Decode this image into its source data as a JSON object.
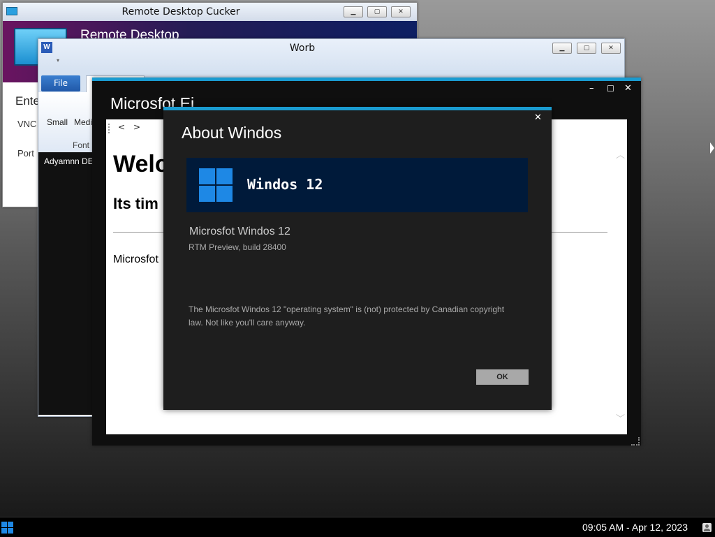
{
  "rdc": {
    "title": "Remote Desktop Cucker",
    "banner_title": "Remote Desktop",
    "enter_label": "Ente",
    "vnc_label": "VNC",
    "port_label": "Port"
  },
  "worb": {
    "title": "Worb",
    "file_tab": "File",
    "font_small": "Small",
    "font_medium": "Medi",
    "font_group_label": "Font",
    "status_text": "Adyamnn DE"
  },
  "browser": {
    "title": "Microsfot Ei",
    "back_label": "<",
    "forward_label": ">",
    "heading": "Welco",
    "subheading": "Its tim",
    "paragraph": "Microsfot"
  },
  "about": {
    "title": "About Windos",
    "close_label": "✕",
    "product_name": "Windos 12",
    "full_name": "Microsfot Windos 12",
    "build": "RTM Preview, build 28400",
    "legal": "The Microsfot Windos 12 \"operating system\" is (not) protected by Canadian copyright law. Not like you'll care anyway.",
    "ok_label": "OK"
  },
  "taskbar": {
    "clock": "09:05 AM - Apr 12, 2023"
  },
  "colors": {
    "accent": "#1a9bd0",
    "logo_blue": "#1e88e5",
    "dialog_bg": "#1e1e1e",
    "banner_bg": "#001a3a",
    "taskbar_bg": "#000000"
  }
}
